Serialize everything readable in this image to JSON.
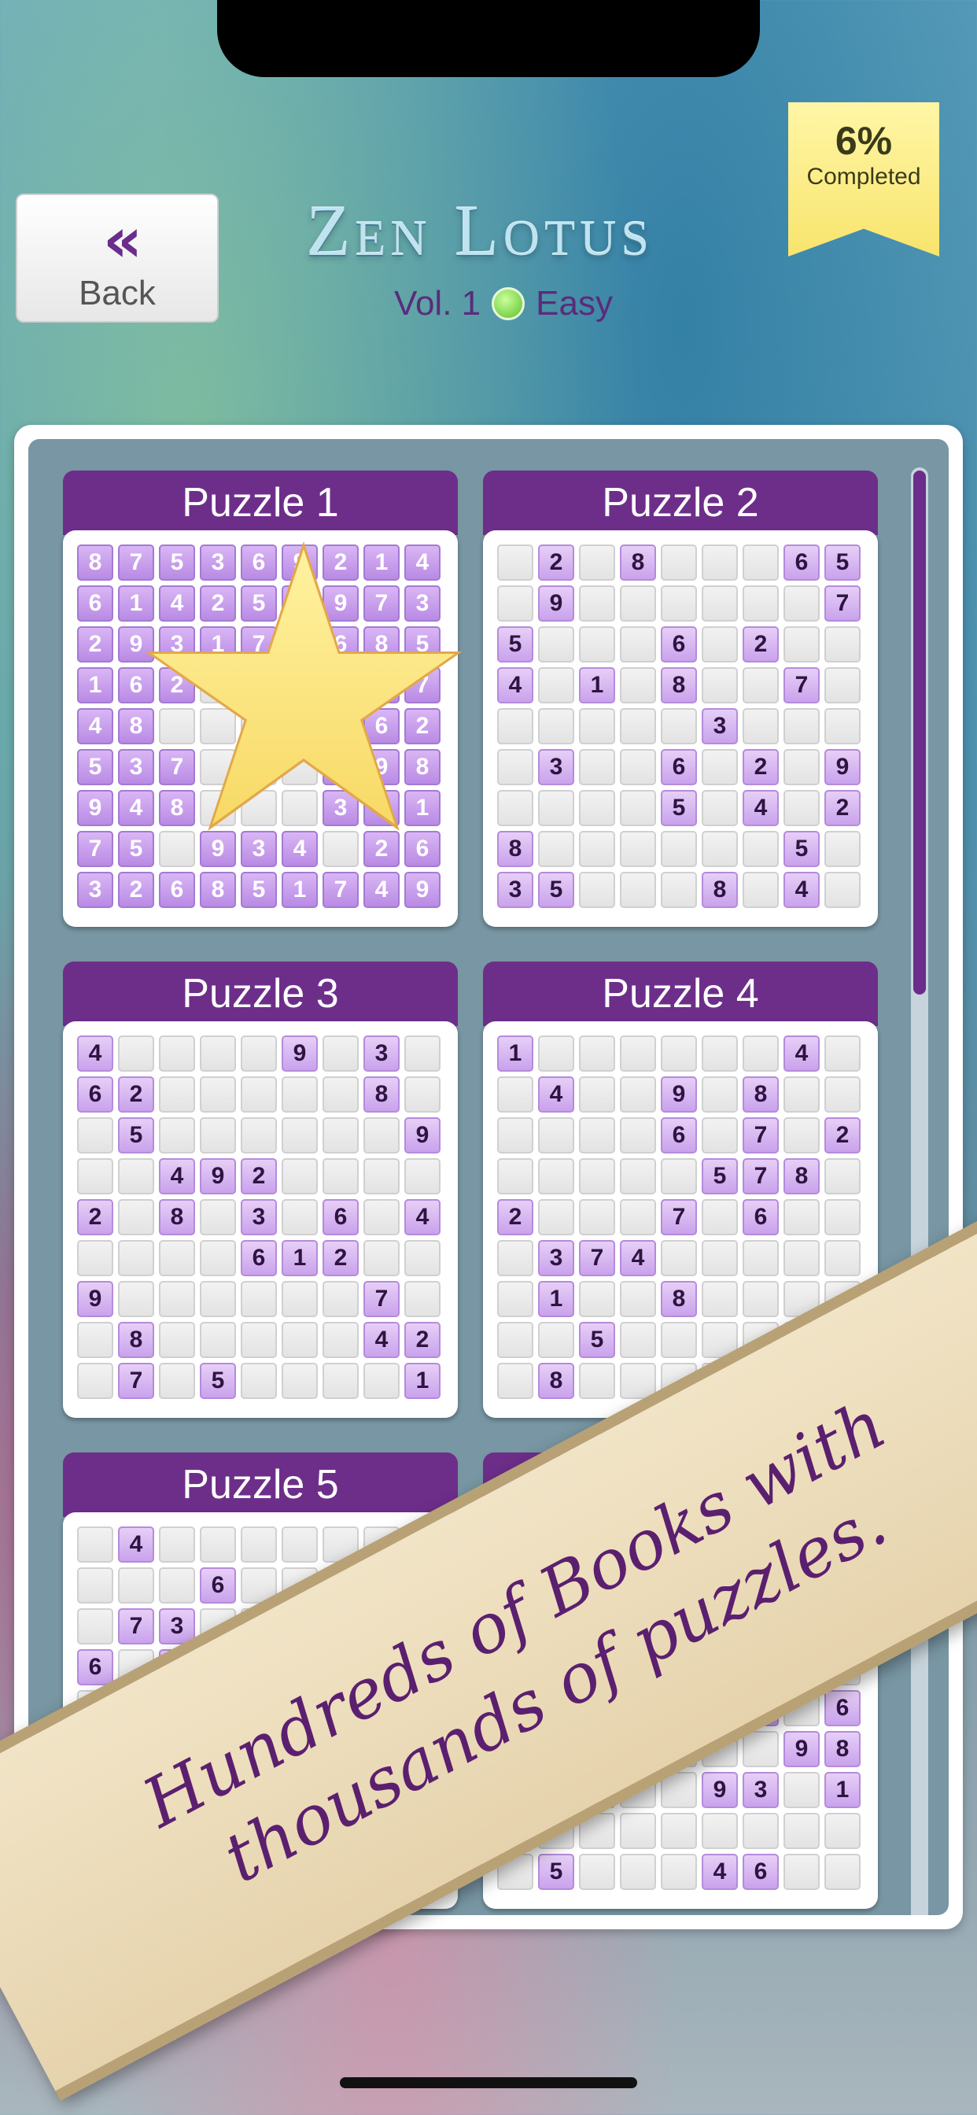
{
  "header": {
    "back_label": "Back",
    "back_icon": "double-chevron-left-icon",
    "title": "Zen Lotus",
    "volume": "Vol. 1",
    "difficulty": "Easy",
    "difficulty_color": "#5fc02b",
    "completion": {
      "percent_text": "6%",
      "label": "Completed",
      "value_percent": 6
    }
  },
  "scroll": {
    "thumb_fraction": 0.36
  },
  "puzzles": [
    {
      "title": "Puzzle 1",
      "completed": true,
      "rows": [
        "875369214",
        "614258973",
        "293174685",
        "162   537",
        "48    162",
        "537   498",
        "948   351",
        "75 934 26",
        "326851749"
      ]
    },
    {
      "title": "Puzzle 2",
      "completed": false,
      "rows": [
        " 2 8   65",
        " 9      7",
        "5   6 2  ",
        "4 1 8  7 ",
        "     3   ",
        " 3  6 2 9",
        "    5 4 2",
        "8      5 ",
        "35   8 4 "
      ]
    },
    {
      "title": "Puzzle 3",
      "completed": false,
      "rows": [
        "4    9 3 ",
        "62     8 ",
        " 5      9",
        "  492    ",
        "2 8 3 6 4",
        "    612  ",
        "9      7 ",
        " 8     42",
        " 7 5    1"
      ]
    },
    {
      "title": "Puzzle 4",
      "completed": false,
      "rows": [
        "1      4 ",
        " 4  9 8  ",
        "    6 7 2",
        "     578 ",
        "2   7 6  ",
        " 374     ",
        " 1  8    ",
        "  5      ",
        " 8       "
      ]
    },
    {
      "title": "Puzzle 5",
      "completed": false,
      "rows": [
        " 4       ",
        "   6     ",
        " 73  9   ",
        "6 4      ",
        " 9       ",
        "         ",
        "         ",
        "         ",
        "         "
      ]
    },
    {
      "title": "",
      "completed": false,
      "rows": [
        "         ",
        "        5",
        "       64",
        "         ",
        "    5 7 6",
        "       98",
        " 26  93 1",
        "7        ",
        " 5   46  "
      ]
    }
  ],
  "banner": {
    "line1": "Hundreds of Books with",
    "line2": "thousands of puzzles."
  },
  "colors": {
    "accent": "#6d2e8a",
    "ribbon": "#f8e46d",
    "banner_text": "#5b1f6f"
  }
}
